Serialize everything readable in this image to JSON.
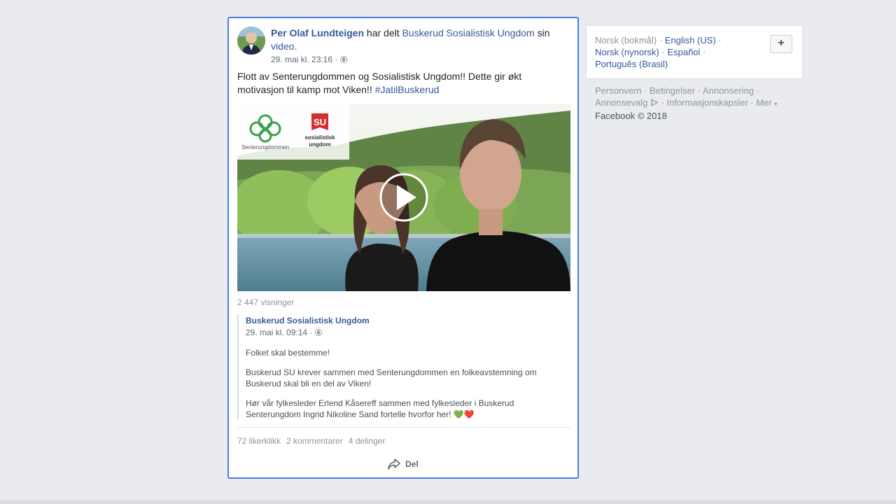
{
  "post": {
    "author": "Per Olaf Lundteigen",
    "shared_phrase": "har delt",
    "shared_page": "Buskerud Sosialistisk Ungdom",
    "possessive": "sin",
    "shared_type": "video.",
    "timestamp": "29. mai kl. 23:16 ·",
    "text": "Flott av Senterungdommen og Sosialistisk Ungdom!! Dette gir økt motivasjon til kamp mot Viken!!",
    "hashtag": "#JatilBuskerud",
    "video": {
      "logo_left_text": "Senterungdommen",
      "logo_right_abbr": "SU",
      "logo_right_text_1": "sosialistisk",
      "logo_right_text_2": "ungdom"
    },
    "views": "2 447 visninger",
    "shared_post": {
      "page": "Buskerud Sosialistisk Ungdom",
      "timestamp": "29. mai kl. 09:14 ·",
      "p1": "Folket skal bestemme!",
      "p2": "Buskerud SU krever sammen med Senterungdommen en folkeavstemning om Buskerud skal bli en del av Viken!",
      "p3": "Hør vår fylkesleder Erlend Kåsereff sammen med fylkesleder i Buskerud Senterungdom Ingrid Nikoline Sand fortelle hvorfor her!",
      "emoji": "💚❤️"
    },
    "stats": {
      "likes": "72 likerklikk",
      "comments": "2 kommentarer",
      "shares": "4 delinger"
    },
    "share_label": "Del"
  },
  "sidebar": {
    "languages": {
      "current": "Norsk (bokmål)",
      "english": "English (US)",
      "nynorsk": "Norsk (nynorsk)",
      "spanish": "Español",
      "portuguese": "Português (Brasil)"
    },
    "plus_label": "+",
    "footer": {
      "privacy": "Personvern",
      "terms": "Betingelser",
      "advertising": "Annonsering",
      "ad_choices": "Annonsevalg",
      "cookies": "Informasjonskapsler",
      "more": "Mer",
      "copyright": "Facebook © 2018"
    }
  },
  "colors": {
    "link": "#365899",
    "focus_border": "#4a7de0",
    "background": "#e9ebee"
  }
}
